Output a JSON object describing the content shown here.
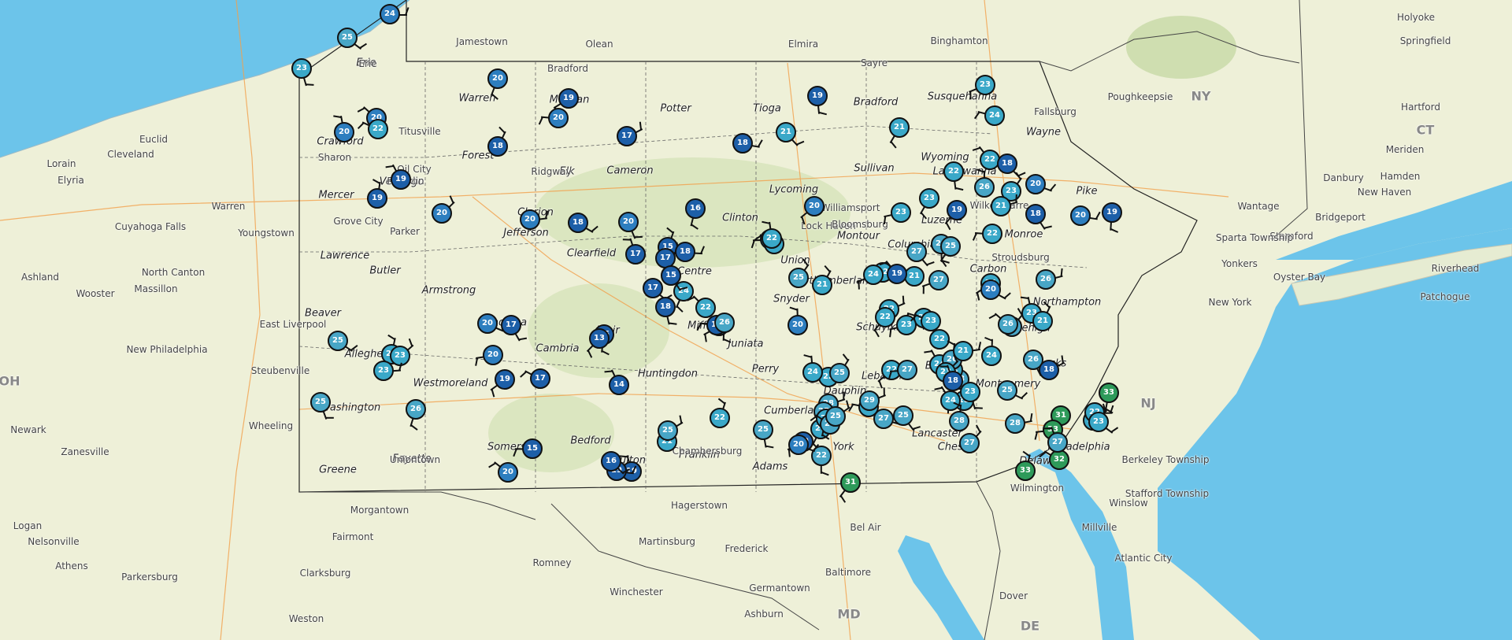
{
  "map": {
    "water_color": "#6cc4ea",
    "land_color": "#eef0d8",
    "state_labels": [
      "NY",
      "CT",
      "NJ",
      "MD",
      "DE",
      "OH"
    ],
    "counties": [
      "Warren",
      "Potter",
      "Tioga",
      "Bradford",
      "Susquehanna",
      "Wayne",
      "Forest",
      "Elk",
      "Cameron",
      "Sullivan",
      "Wyoming",
      "Mercer",
      "Venango",
      "Lycoming",
      "Lackawanna",
      "Pike",
      "Luzerne",
      "Columbia",
      "Monroe",
      "Lawrence",
      "Butler",
      "Armstrong",
      "Clearfield",
      "Union",
      "Carbon",
      "Northumberland",
      "Snyder",
      "Northampton",
      "Cambria",
      "Juniata",
      "Lehigh",
      "Huntingdon",
      "Perry",
      "Dauphin",
      "Lebanon",
      "Westmoreland",
      "Cumberland",
      "Lancaster",
      "Bedford",
      "Franklin",
      "Adams",
      "York",
      "Chester",
      "Delaware",
      "Greene",
      "Fayette",
      "Somerset",
      "Beaver",
      "Washington",
      "Allegheny",
      "Indiana",
      "Clarion",
      "Jefferson",
      "Centre",
      "Crawford",
      "Erie",
      "McKean",
      "Clinton",
      "Montgomery",
      "Bucks",
      "Philadelphia",
      "Schuylkill",
      "Berks",
      "Mifflin",
      "Blair",
      "Fulton",
      "Montour"
    ],
    "cities": [
      "Jamestown",
      "Olean",
      "Elmira",
      "Binghamton",
      "Bradford",
      "Erie",
      "Titusville",
      "Oil City",
      "Franklin",
      "Cleveland",
      "Elyria",
      "Lorain",
      "Euclid",
      "Warren",
      "Cuyahoga Falls",
      "Youngstown",
      "Ashland",
      "Wooster",
      "Massillon",
      "North Canton",
      "New Philadelphia",
      "Steubenville",
      "Wheeling",
      "Newark",
      "Zanesville",
      "Morgantown",
      "Fairmont",
      "Clarksburg",
      "Logan",
      "Nelsonville",
      "Athens",
      "Parkersburg",
      "Weston",
      "Romney",
      "Martinsburg",
      "Hagerstown",
      "Frederick",
      "Winchester",
      "Germantown",
      "Baltimore",
      "Bel Air",
      "Ashburn",
      "Dover",
      "Wilmington",
      "Millville",
      "Atlantic City",
      "Winslow",
      "Stafford Township",
      "Berkeley Township",
      "New York",
      "Yonkers",
      "Stamford",
      "Bridgeport",
      "Hartford",
      "Meriden",
      "Hamden",
      "New Haven",
      "Danbury",
      "Riverhead",
      "Patchogue",
      "Oyster Bay",
      "Sparta Township",
      "Wantage",
      "Fallsburg",
      "Poughkeepsie",
      "Holyoke",
      "Springfield",
      "Lock Haven",
      "Williamsport",
      "Bloomsburg",
      "Stroudsburg",
      "Wilkes-Barre",
      "Grove City",
      "Parker",
      "East Liverpool",
      "Uniontown",
      "Chambersburg",
      "Sayre",
      "Sharon",
      "Ridgway"
    ],
    "stations": [
      {
        "v": "24",
        "c": "#2d7ebf"
      },
      {
        "v": "25",
        "c": "#48a6c6"
      },
      {
        "v": "23",
        "c": "#3aa8c8"
      },
      {
        "v": "20",
        "c": "#2d7ebf"
      },
      {
        "v": "19",
        "c": "#1d5fa8"
      },
      {
        "v": "20",
        "c": "#2d7ebf"
      },
      {
        "v": "20",
        "c": "#2d7ebf"
      },
      {
        "v": "20",
        "c": "#2d7ebf"
      },
      {
        "v": "18",
        "c": "#1d5fa8"
      },
      {
        "v": "17",
        "c": "#1d5fa8"
      },
      {
        "v": "18",
        "c": "#1d5fa8"
      },
      {
        "v": "21",
        "c": "#3aa8c8"
      },
      {
        "v": "19",
        "c": "#1d5fa8"
      },
      {
        "v": "21",
        "c": "#3aa8c8"
      },
      {
        "v": "23",
        "c": "#3aa8c8"
      },
      {
        "v": "24",
        "c": "#3aa8c8"
      },
      {
        "v": "22",
        "c": "#3aa8c8"
      },
      {
        "v": "26",
        "c": "#48a6c6"
      },
      {
        "v": "23",
        "c": "#3aa8c8"
      },
      {
        "v": "21",
        "c": "#3aa8c8"
      },
      {
        "v": "20",
        "c": "#2d7ebf"
      },
      {
        "v": "18",
        "c": "#1d5fa8"
      },
      {
        "v": "19",
        "c": "#1d5fa8"
      },
      {
        "v": "19",
        "c": "#1d5fa8"
      },
      {
        "v": "23",
        "c": "#3aa8c8"
      },
      {
        "v": "22",
        "c": "#3aa8c8"
      },
      {
        "v": "19",
        "c": "#1d5fa8"
      },
      {
        "v": "19",
        "c": "#1d5fa8"
      },
      {
        "v": "20",
        "c": "#2d7ebf"
      },
      {
        "v": "20",
        "c": "#2d7ebf"
      },
      {
        "v": "18",
        "c": "#1d5fa8"
      },
      {
        "v": "20",
        "c": "#2d7ebf"
      },
      {
        "v": "16",
        "c": "#1d5fa8"
      },
      {
        "v": "20",
        "c": "#2d7ebf"
      },
      {
        "v": "22",
        "c": "#3aa8c8"
      },
      {
        "v": "21",
        "c": "#3aa8c8"
      },
      {
        "v": "17",
        "c": "#1d5fa8"
      },
      {
        "v": "15",
        "c": "#1d5fa8"
      },
      {
        "v": "17",
        "c": "#1d5fa8"
      },
      {
        "v": "18",
        "c": "#1d5fa8"
      },
      {
        "v": "17",
        "c": "#1d5fa8"
      },
      {
        "v": "18",
        "c": "#1d5fa8"
      },
      {
        "v": "24",
        "c": "#3aa8c8"
      },
      {
        "v": "23",
        "c": "#3aa8c8"
      },
      {
        "v": "18",
        "c": "#1d5fa8"
      },
      {
        "v": "22",
        "c": "#3aa8c8"
      },
      {
        "v": "22",
        "c": "#3aa8c8"
      },
      {
        "v": "21",
        "c": "#3aa8c8"
      },
      {
        "v": "22",
        "c": "#3aa8c8"
      },
      {
        "v": "22",
        "c": "#3aa8c8"
      },
      {
        "v": "27",
        "c": "#48a6c6"
      },
      {
        "v": "28",
        "c": "#48a6c6"
      },
      {
        "v": "25",
        "c": "#48a6c6"
      },
      {
        "v": "27",
        "c": "#48a6c6"
      },
      {
        "v": "23",
        "c": "#3aa8c8"
      },
      {
        "v": "22",
        "c": "#3aa8c8"
      },
      {
        "v": "24",
        "c": "#3aa8c8"
      },
      {
        "v": "25",
        "c": "#48a6c6"
      },
      {
        "v": "26",
        "c": "#48a6c6"
      },
      {
        "v": "20",
        "c": "#2d7ebf"
      },
      {
        "v": "17",
        "c": "#1d5fa8"
      },
      {
        "v": "15",
        "c": "#1d5fa8"
      },
      {
        "v": "13",
        "c": "#1d5fa8"
      },
      {
        "v": "20",
        "c": "#2d7ebf"
      },
      {
        "v": "17",
        "c": "#1d5fa8"
      },
      {
        "v": "14",
        "c": "#1d5fa8"
      },
      {
        "v": "23",
        "c": "#3aa8c8"
      },
      {
        "v": "23",
        "c": "#3aa8c8"
      },
      {
        "v": "23",
        "c": "#3aa8c8"
      },
      {
        "v": "25",
        "c": "#48a6c6"
      },
      {
        "v": "25",
        "c": "#48a6c6"
      },
      {
        "v": "26",
        "c": "#48a6c6"
      },
      {
        "v": "19",
        "c": "#1d5fa8"
      },
      {
        "v": "15",
        "c": "#1d5fa8"
      },
      {
        "v": "20",
        "c": "#2d7ebf"
      },
      {
        "v": "19",
        "c": "#1d5fa8"
      },
      {
        "v": "21",
        "c": "#3aa8c8"
      },
      {
        "v": "25",
        "c": "#48a6c6"
      },
      {
        "v": "19",
        "c": "#1d5fa8"
      },
      {
        "v": "16",
        "c": "#1d5fa8"
      },
      {
        "v": "25",
        "c": "#48a6c6"
      },
      {
        "v": "21",
        "c": "#3aa8c8"
      },
      {
        "v": "19",
        "c": "#1d5fa8"
      },
      {
        "v": "24",
        "c": "#3aa8c8"
      },
      {
        "v": "22",
        "c": "#3aa8c8"
      },
      {
        "v": "24",
        "c": "#3aa8c8"
      },
      {
        "v": "25",
        "c": "#48a6c6"
      },
      {
        "v": "29",
        "c": "#48a6c6"
      },
      {
        "v": "27",
        "c": "#48a6c6"
      },
      {
        "v": "25",
        "c": "#48a6c6"
      },
      {
        "v": "22",
        "c": "#48a6c6"
      },
      {
        "v": "31",
        "c": "#2e9a5a"
      },
      {
        "v": "23",
        "c": "#3aa8c8"
      },
      {
        "v": "28",
        "c": "#48a6c6"
      },
      {
        "v": "24",
        "c": "#3aa8c8"
      },
      {
        "v": "28",
        "c": "#48a6c6"
      },
      {
        "v": "27",
        "c": "#48a6c6"
      },
      {
        "v": "28",
        "c": "#48a6c6"
      },
      {
        "v": "25",
        "c": "#48a6c6"
      },
      {
        "v": "26",
        "c": "#48a6c6"
      },
      {
        "v": "33",
        "c": "#2e9a5a"
      },
      {
        "v": "31",
        "c": "#2e9a5a"
      },
      {
        "v": "33",
        "c": "#2e9a5a"
      },
      {
        "v": "32",
        "c": "#2e9a5a"
      },
      {
        "v": "27",
        "c": "#48a6c6"
      },
      {
        "v": "33",
        "c": "#2e9a5a"
      },
      {
        "v": "24",
        "c": "#3aa8c8"
      },
      {
        "v": "22",
        "c": "#3aa8c8"
      },
      {
        "v": "23",
        "c": "#3aa8c8"
      },
      {
        "v": "23",
        "c": "#3aa8c8"
      },
      {
        "v": "22",
        "c": "#3aa8c8"
      },
      {
        "v": "24",
        "c": "#3aa8c8"
      },
      {
        "v": "22",
        "c": "#3aa8c8"
      },
      {
        "v": "26",
        "c": "#48a6c6"
      },
      {
        "v": "23",
        "c": "#3aa8c8"
      },
      {
        "v": "21",
        "c": "#3aa8c8"
      },
      {
        "v": "18",
        "c": "#1d5fa8"
      },
      {
        "v": "20",
        "c": "#2d7ebf"
      },
      {
        "v": "18",
        "c": "#1d5fa8"
      },
      {
        "v": "22",
        "c": "#3aa8c8"
      },
      {
        "v": "23",
        "c": "#3aa8c8"
      },
      {
        "v": "24",
        "c": "#3aa8c8"
      },
      {
        "v": "21",
        "c": "#3aa8c8"
      },
      {
        "v": "19",
        "c": "#1d5fa8"
      },
      {
        "v": "20",
        "c": "#2d7ebf"
      },
      {
        "v": "25",
        "c": "#48a6c6"
      },
      {
        "v": "28",
        "c": "#48a6c6"
      },
      {
        "v": "20",
        "c": "#2d7ebf"
      },
      {
        "v": "15",
        "c": "#1d5fa8"
      },
      {
        "v": "26",
        "c": "#48a6c6"
      },
      {
        "v": "22",
        "c": "#3aa8c8"
      },
      {
        "v": "23",
        "c": "#3aa8c8"
      },
      {
        "v": "23",
        "c": "#3aa8c8"
      },
      {
        "v": "24",
        "c": "#3aa8c8"
      },
      {
        "v": "26",
        "c": "#48a6c6"
      },
      {
        "v": "23",
        "c": "#3aa8c8"
      },
      {
        "v": "21",
        "c": "#3aa8c8"
      },
      {
        "v": "20",
        "c": "#2d7ebf"
      },
      {
        "v": "25",
        "c": "#48a6c6"
      },
      {
        "v": "24",
        "c": "#3aa8c8"
      },
      {
        "v": "22",
        "c": "#3aa8c8"
      },
      {
        "v": "27",
        "c": "#48a6c6"
      },
      {
        "v": "28",
        "c": "#48a6c6"
      },
      {
        "v": "18",
        "c": "#1d5fa8"
      },
      {
        "v": "22",
        "c": "#3aa8c8"
      },
      {
        "v": "25",
        "c": "#48a6c6"
      }
    ]
  }
}
